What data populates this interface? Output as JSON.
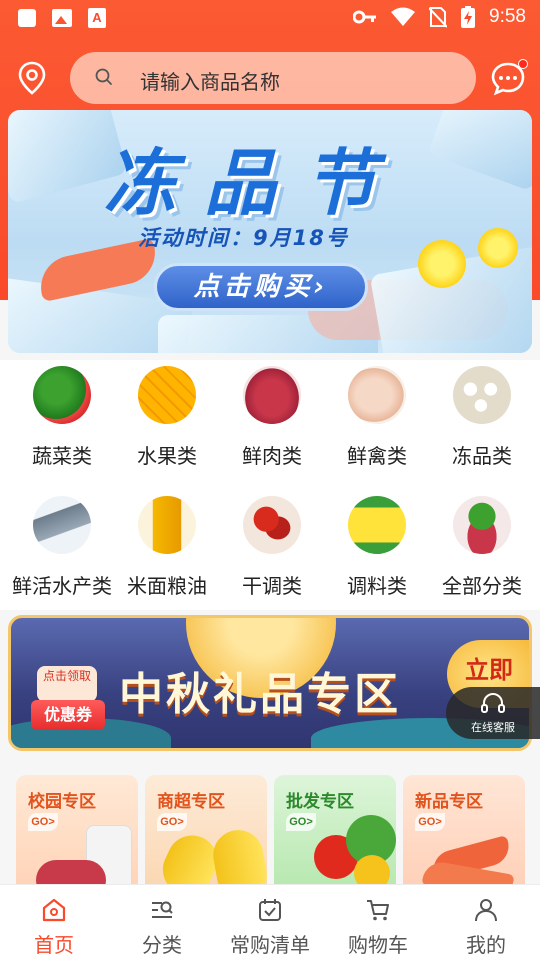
{
  "status_bar": {
    "time": "9:58",
    "left_icons": [
      "square-notification-icon",
      "image-icon",
      "a-app-icon"
    ],
    "right_icons": [
      "key-icon",
      "wifi-icon",
      "no-sim-icon",
      "battery-charging-icon"
    ]
  },
  "header": {
    "location_icon": "location-pin-icon",
    "search_placeholder": "请输入商品名称",
    "message_icon": "chat-bubble-icon",
    "accent_color": "#fa4a2a"
  },
  "hero_banner": {
    "title": "冻品节",
    "date_line": "活动时间：9月18号",
    "button_label": "点击购买›"
  },
  "categories": [
    {
      "label": "蔬菜类",
      "icon": "vegetables-icon"
    },
    {
      "label": "水果类",
      "icon": "mango-icon"
    },
    {
      "label": "鲜肉类",
      "icon": "meat-icon"
    },
    {
      "label": "鲜禽类",
      "icon": "poultry-icon"
    },
    {
      "label": "冻品类",
      "icon": "frozen-dumplings-icon"
    },
    {
      "label": "鲜活水产类",
      "icon": "fish-icon"
    },
    {
      "label": "米面粮油",
      "icon": "oil-bottle-icon"
    },
    {
      "label": "干调类",
      "icon": "dried-chili-icon"
    },
    {
      "label": "调料类",
      "icon": "seasoning-pack-icon"
    },
    {
      "label": "全部分类",
      "icon": "all-categories-icon"
    }
  ],
  "promo_banner": {
    "title": "中秋礼品专区",
    "coupon_top": "点击领取",
    "coupon_label": "优惠券",
    "cta": "立即"
  },
  "customer_service": {
    "label": "在线客服",
    "icon": "headset-icon"
  },
  "zones": [
    {
      "title": "校园专区",
      "go": "GO>"
    },
    {
      "title": "商超专区",
      "go": "GO>"
    },
    {
      "title": "批发专区",
      "go": "GO>"
    },
    {
      "title": "新品专区",
      "go": "GO>"
    }
  ],
  "bottom_nav": [
    {
      "label": "首页",
      "icon": "home-icon",
      "active": true
    },
    {
      "label": "分类",
      "icon": "category-search-icon",
      "active": false
    },
    {
      "label": "常购清单",
      "icon": "checklist-icon",
      "active": false
    },
    {
      "label": "购物车",
      "icon": "cart-icon",
      "active": false
    },
    {
      "label": "我的",
      "icon": "user-icon",
      "active": false
    }
  ]
}
